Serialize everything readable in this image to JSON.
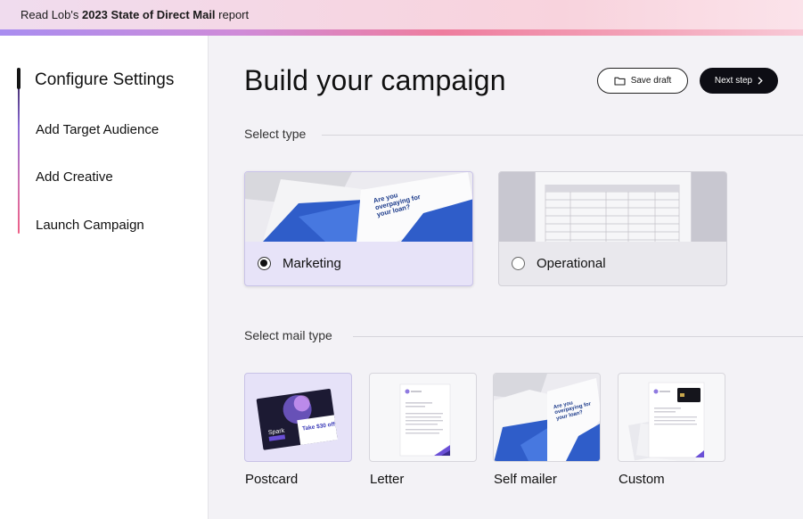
{
  "banner": {
    "prefix": "Read Lob's ",
    "bold": "2023 State of Direct Mail",
    "suffix": " report"
  },
  "steps": [
    {
      "label": "Configure Settings",
      "active": true
    },
    {
      "label": "Add Target Audience",
      "active": false
    },
    {
      "label": "Add Creative",
      "active": false
    },
    {
      "label": "Launch Campaign",
      "active": false
    }
  ],
  "header": {
    "title": "Build your campaign",
    "save_draft": "Save draft",
    "next_step": "Next step"
  },
  "select_type": {
    "label": "Select type",
    "options": [
      {
        "label": "Marketing",
        "selected": true,
        "thumb_text": "Are you overpaying for your loan?"
      },
      {
        "label": "Operational",
        "selected": false
      }
    ]
  },
  "select_mail_type": {
    "label": "Select mail type",
    "options": [
      {
        "label": "Postcard",
        "selected": true,
        "thumb_brand": "Spark",
        "thumb_offer": "Take $30 off"
      },
      {
        "label": "Letter",
        "selected": false
      },
      {
        "label": "Self mailer",
        "selected": false,
        "thumb_text": "Are you overpaying for your loan?"
      },
      {
        "label": "Custom",
        "selected": false
      }
    ]
  },
  "colors": {
    "accent": "#6a4fd6",
    "selected_bg": "#e7e3f8",
    "dark_button": "#0d0d14",
    "brochure_blue": "#2f5dc9"
  }
}
